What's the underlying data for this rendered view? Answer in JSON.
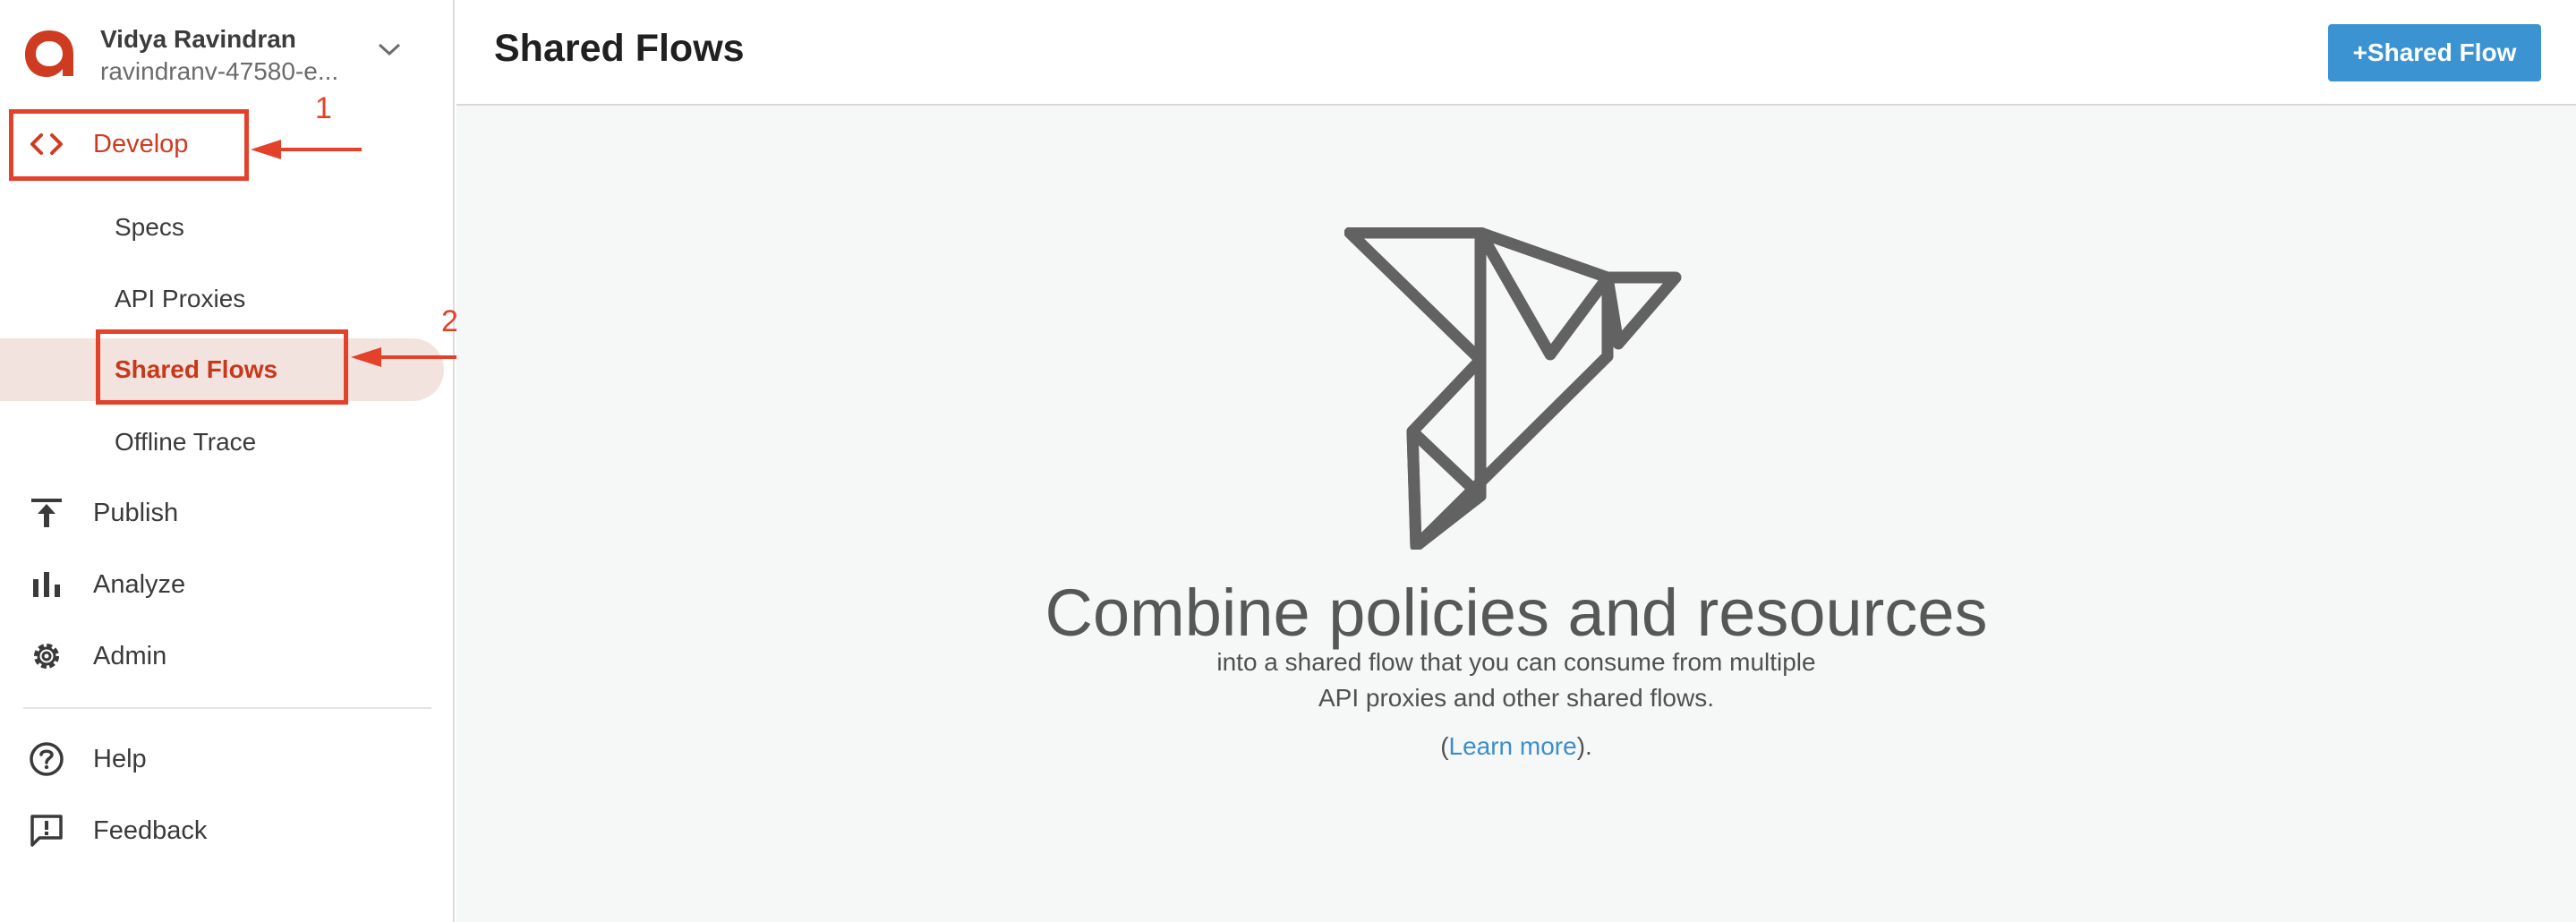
{
  "user": {
    "name": "Vidya Ravindran",
    "org": "ravindranv-47580-e...",
    "logo_letter": "a",
    "toggle_icon": "chevron-down-icon"
  },
  "sidebar": {
    "develop": {
      "label": "Develop",
      "icon": "code-brackets-icon"
    },
    "develop_items": [
      {
        "label": "Specs"
      },
      {
        "label": "API Proxies"
      },
      {
        "label": "Shared Flows",
        "selected": true
      },
      {
        "label": "Offline Trace"
      }
    ],
    "publish": {
      "label": "Publish",
      "icon": "publish-upload-icon"
    },
    "analyze": {
      "label": "Analyze",
      "icon": "bar-chart-icon"
    },
    "admin": {
      "label": "Admin",
      "icon": "gear-icon"
    },
    "help": {
      "label": "Help",
      "icon": "help-circle-icon"
    },
    "feedback": {
      "label": "Feedback",
      "icon": "feedback-icon"
    }
  },
  "annotations": [
    {
      "number": "1"
    },
    {
      "number": "2"
    }
  ],
  "header": {
    "title": "Shared Flows",
    "add_button": "+Shared Flow"
  },
  "empty_state": {
    "icon": "origami-bird-icon",
    "heading": "Combine policies and resources",
    "line1": "into a shared flow that you can consume from multiple",
    "line2": "API proxies and other shared flows.",
    "learn_open": "(",
    "learn_link": "Learn more",
    "learn_close": ")."
  },
  "colors": {
    "brand": "#cf3b21",
    "annotation": "#e4412b",
    "button": "#3b93d1",
    "link": "#3b8fcb",
    "selected_bg": "#f3e3de"
  }
}
